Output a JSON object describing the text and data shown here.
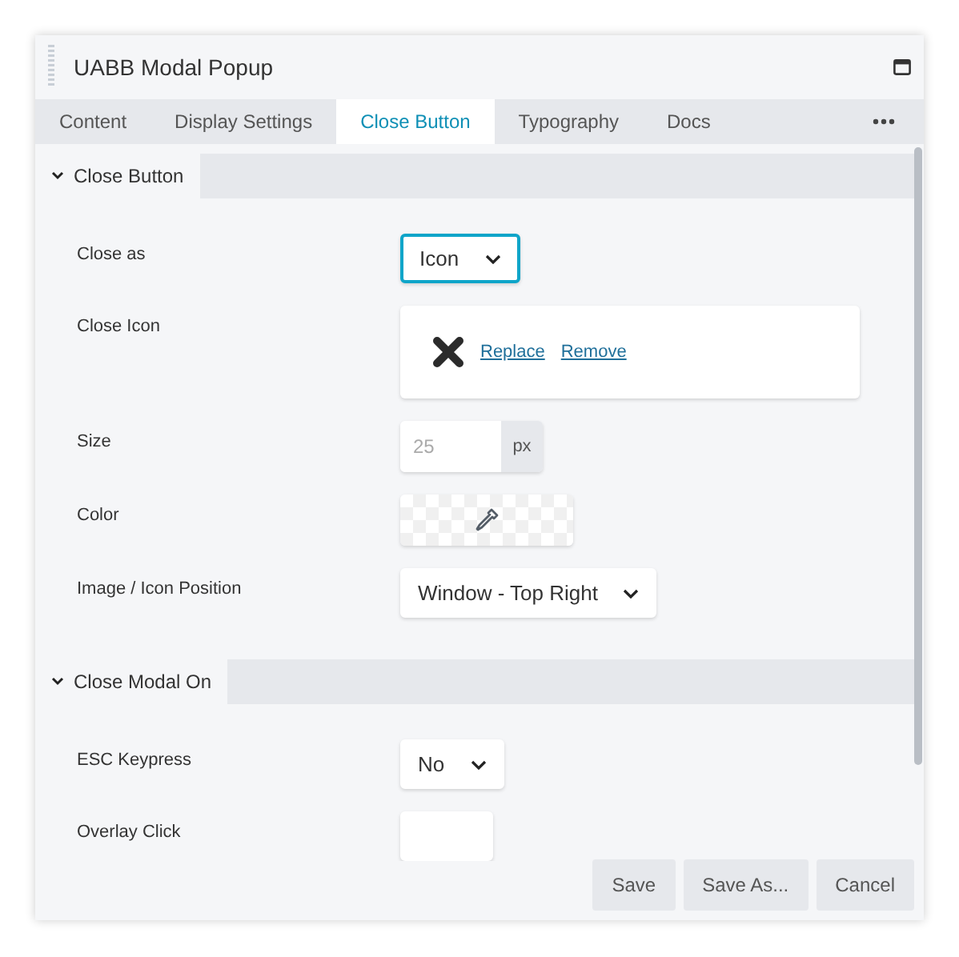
{
  "window": {
    "title": "UABB Modal Popup"
  },
  "tabs": [
    {
      "label": "Content",
      "selected": false
    },
    {
      "label": "Display Settings",
      "selected": false
    },
    {
      "label": "Close Button",
      "selected": true
    },
    {
      "label": "Typography",
      "selected": false
    },
    {
      "label": "Docs",
      "selected": false
    }
  ],
  "sections": [
    {
      "title": "Close Button",
      "expanded": true,
      "fields": [
        {
          "kind": "select",
          "label": "Close as",
          "value": "Icon",
          "focused": true
        },
        {
          "kind": "icon",
          "label": "Close Icon",
          "actions": [
            "Replace",
            "Remove"
          ]
        },
        {
          "kind": "unit",
          "label": "Size",
          "placeholder": "25",
          "unit": "px"
        },
        {
          "kind": "color",
          "label": "Color"
        },
        {
          "kind": "select",
          "label": "Image / Icon Position",
          "value": "Window - Top Right",
          "focused": false
        }
      ]
    },
    {
      "title": "Close Modal On",
      "expanded": true,
      "fields": [
        {
          "kind": "select",
          "label": "ESC Keypress",
          "value": "No",
          "focused": false
        },
        {
          "kind": "select",
          "label": "Overlay Click",
          "focused": false
        }
      ]
    }
  ],
  "footer_buttons": [
    "Save",
    "Save As...",
    "Cancel"
  ]
}
